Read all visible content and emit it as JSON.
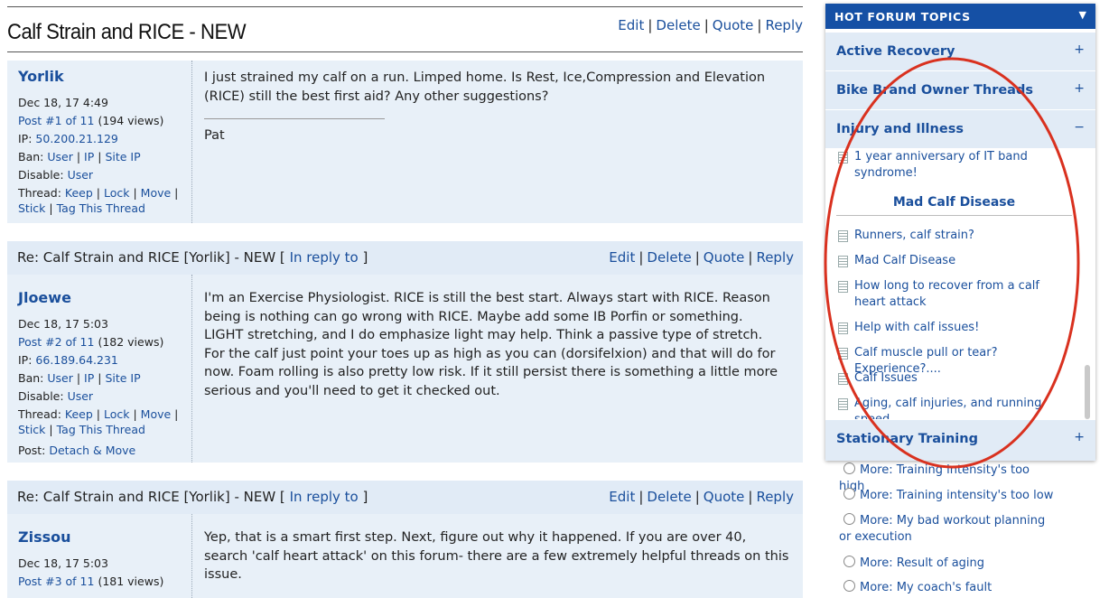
{
  "thread": {
    "title": "Calf Strain and RICE - NEW",
    "actions": [
      "Edit",
      "Delete",
      "Quote",
      "Reply"
    ]
  },
  "posts": [
    {
      "author": "Yorlik",
      "date": "Dec 18, 17 4:49",
      "post_link": "Post #1 of 11",
      "views": "(194 views)",
      "ip_label": "IP:",
      "ip": "50.200.21.129",
      "ban_label": "Ban:",
      "ban_user": "User",
      "ban_ip": "IP",
      "ban_site_ip": "Site IP",
      "disable_label": "Disable:",
      "disable_user": "User",
      "thread_label": "Thread:",
      "keep": "Keep",
      "lock": "Lock",
      "move": "Move",
      "stick": "Stick",
      "tag": "Tag This Thread",
      "body": "I just strained my calf on a run. Limped home. Is Rest, Ice,Compression and Elevation (RICE) still the best first aid? Any other suggestions?",
      "signature": "Pat"
    },
    {
      "heading": "Re: Calf Strain and RICE [Yorlik] - NEW [",
      "in_reply_to": "In reply to",
      "heading_end": "]",
      "author": "Jloewe",
      "date": "Dec 18, 17 5:03",
      "post_link": "Post #2 of 11",
      "views": "(182 views)",
      "ip_label": "IP:",
      "ip": "66.189.64.231",
      "ban_label": "Ban:",
      "ban_user": "User",
      "ban_ip": "IP",
      "ban_site_ip": "Site IP",
      "disable_label": "Disable:",
      "disable_user": "User",
      "thread_label": "Thread:",
      "keep": "Keep",
      "lock": "Lock",
      "move": "Move",
      "stick": "Stick",
      "tag": "Tag This Thread",
      "post_label": "Post:",
      "detach": "Detach & Move",
      "body": "I'm an Exercise Physiologist. RICE is still the best start. Always start with RICE. Reason being is nothing can go wrong with RICE. Maybe add some IB Porfin or something. LIGHT stretching, and I do emphasize light may help. Think a passive type of stretch. For the calf just point your toes up as high as you can (dorsifelxion) and that will do for now. Foam rolling is also pretty low risk. If it still persist there is something a little more serious and you'll need to get it checked out."
    },
    {
      "heading": "Re: Calf Strain and RICE [Yorlik] - NEW [",
      "in_reply_to": "In reply to",
      "heading_end": "]",
      "author": "Zissou",
      "date": "Dec 18, 17 5:03",
      "post_link": "Post #3 of 11",
      "views": "(181 views)",
      "body": "Yep, that is a smart first step. Next, figure out why it happened. If you are over 40, search 'calf heart attack' on this forum- there are a few extremely helpful threads on this issue."
    }
  ],
  "sidebar": {
    "header": "HOT FORUM TOPICS",
    "sections": [
      {
        "label": "Active Recovery",
        "toggle": "+"
      },
      {
        "label": "Bike Brand Owner Threads",
        "toggle": "+"
      },
      {
        "label": "Injury and Illness",
        "toggle": "−"
      },
      {
        "label": "Stationary Training",
        "toggle": "+"
      }
    ],
    "topics_before": [
      "1 year anniversary of IT band syndrome!"
    ],
    "subheading": "Mad Calf Disease",
    "topics": [
      "Runners, calf strain?",
      "Mad Calf Disease",
      "How long to recover from a calf heart attack",
      "Help with calf issues!",
      "Calf muscle pull or tear? Experience?....",
      "Calf Issues",
      "Aging, calf injuries, and running speed"
    ],
    "poll_options": [
      "More: Training intensity's too high",
      "More: Training intensity's too low",
      "More: My bad workout planning or execution",
      "More: Result of aging",
      "More: My coach's fault"
    ]
  },
  "colors": {
    "accent": "#1550a5",
    "link": "#1a4f9c",
    "annotation": "#d9311f"
  }
}
